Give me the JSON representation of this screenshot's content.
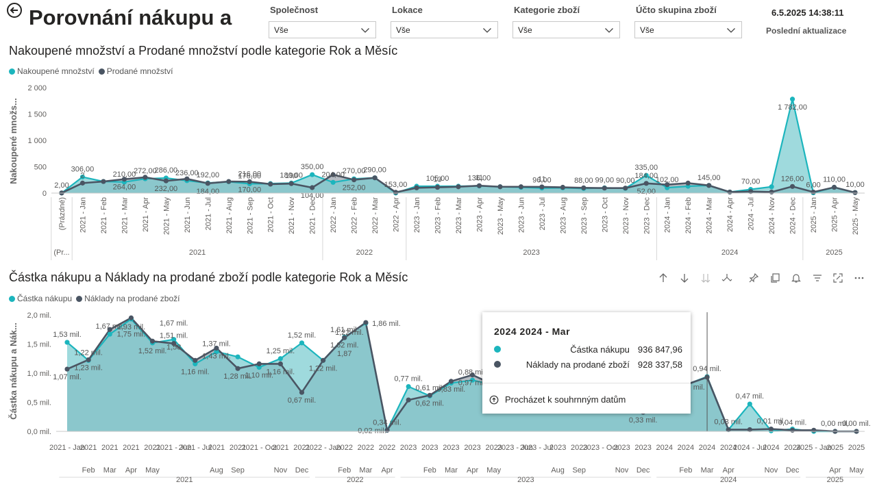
{
  "header": {
    "title": "Porovnání nákupu a",
    "datetime": "6.5.2025 14:38:11",
    "last_update_label": "Poslední aktualizace"
  },
  "slicers": [
    {
      "label": "Společnost",
      "value": "Vše"
    },
    {
      "label": "Lokace",
      "value": "Vše"
    },
    {
      "label": "Kategorie zboží",
      "value": "Vše"
    },
    {
      "label": "Účto skupina zboží",
      "value": "Vše"
    }
  ],
  "colors": {
    "teal": "#1CB5BD",
    "dark": "#4A5563",
    "teal_fill": "#7ACCD0",
    "dark_fill": "#9AA2AC"
  },
  "tooltip": {
    "header": "2024 2024 - Mar",
    "rows": [
      {
        "label": "Částka nákupu",
        "value": "936 847,96"
      },
      {
        "label": "Náklady na prodané zboží",
        "value": "928 337,58"
      }
    ],
    "action": "Procházet k souhrnným datům"
  },
  "toolbar_icons": [
    "arrow-up-icon",
    "arrow-down-icon",
    "double-arrow-down-icon",
    "fork-icon",
    "pin-icon",
    "copy-icon",
    "bell-icon",
    "filter-icon",
    "focus-icon",
    "more-icon"
  ],
  "chart_data": [
    {
      "type": "area",
      "title": "Nakoupené množství a Prodané množství podle kategorie Rok a Měsíc",
      "ylabel": "Nakoupené množs...",
      "ylim": [
        0,
        2000
      ],
      "yticks": [
        "0",
        "500",
        "1 000",
        "1 500",
        "2 000"
      ],
      "legend_position": "top-left",
      "legend": [
        "Nakoupené množství",
        "Prodané množství"
      ],
      "categories": [
        "(Prázdné)",
        "2021 - Jan",
        "2021 - Feb",
        "2021 - Mar",
        "2021 - Apr",
        "2021 - May",
        "2021 - Jun",
        "2021 - Jul",
        "2021 - Aug",
        "2021 - Sep",
        "2021 - Oct",
        "2021 - Nov",
        "2021 - Dec",
        "2022 - Jan",
        "2022 - Feb",
        "2022 - Mar",
        "2022 - Apr",
        "2023 - Jan",
        "2023 - Feb",
        "2023 - Mar",
        "2023 - Apr",
        "2023 - May",
        "2023 - Jun",
        "2023 - Jul",
        "2023 - Aug",
        "2023 - Sep",
        "2023 - Oct",
        "2023 - Nov",
        "2023 - Dec",
        "2024 - Jan",
        "2024 - Feb",
        "2024 - Mar",
        "2024 - Apr",
        "2024 - Jul",
        "2024 - Nov",
        "2024 - Dec",
        "2025 - Jan",
        "2025 - Apr",
        "2025 - May"
      ],
      "year_groups": [
        {
          "label": "(Pr...",
          "start": 0,
          "end": 0
        },
        {
          "label": "2021",
          "start": 1,
          "end": 12
        },
        {
          "label": "2022",
          "start": 13,
          "end": 16
        },
        {
          "label": "2023",
          "start": 17,
          "end": 28
        },
        {
          "label": "2024",
          "start": 29,
          "end": 35
        },
        {
          "label": "2025",
          "start": 36,
          "end": 38
        }
      ],
      "series": [
        {
          "name": "Nakoupené množství",
          "color": "#1CB5BD",
          "values": [
            2,
            306,
            220,
            210,
            272,
            286,
            236,
            192,
            216,
            176,
            180,
            190,
            350,
            204,
            270,
            290,
            2,
            130,
            130,
            130,
            136,
            120,
            110,
            96,
            100,
            88,
            99,
            90,
            335,
            102,
            130,
            145,
            20,
            70,
            120,
            1782,
            6,
            110,
            10
          ]
        },
        {
          "name": "Prodané množství",
          "color": "#4A5563",
          "values": [
            2,
            190,
            220,
            264,
            300,
            232,
            270,
            184,
            220,
            216,
            170,
            180,
            104,
            350,
            252,
            290,
            15,
            100,
            110,
            120,
            140,
            120,
            120,
            118,
            110,
            100,
            95,
            95,
            184,
            160,
            190,
            145,
            20,
            30,
            20,
            126,
            20,
            110,
            10
          ]
        }
      ],
      "data_labels": [
        {
          "i": 0,
          "text": "2,00",
          "s": 0,
          "pos": "above"
        },
        {
          "i": 1,
          "text": "306,00",
          "s": 0,
          "pos": "above"
        },
        {
          "i": 1,
          "text": "2",
          "s": 1,
          "pos": "above"
        },
        {
          "i": 3,
          "text": "210,00",
          "s": 0,
          "pos": "above"
        },
        {
          "i": 3,
          "text": "264,00",
          "s": 1,
          "pos": "below"
        },
        {
          "i": 4,
          "text": "272,00",
          "s": 0,
          "pos": "above"
        },
        {
          "i": 5,
          "text": "286,00",
          "s": 0,
          "pos": "above"
        },
        {
          "i": 5,
          "text": "232,00",
          "s": 1,
          "pos": "below"
        },
        {
          "i": 6,
          "text": "236,00",
          "s": 0,
          "pos": "above"
        },
        {
          "i": 7,
          "text": "192,00",
          "s": 0,
          "pos": "above"
        },
        {
          "i": 7,
          "text": "184,00",
          "s": 1,
          "pos": "below"
        },
        {
          "i": 9,
          "text": "176,00",
          "s": 0,
          "pos": "above"
        },
        {
          "i": 9,
          "text": "216,00",
          "s": 1,
          "pos": "above"
        },
        {
          "i": 9,
          "text": "170,00",
          "s": 1,
          "pos": "below"
        },
        {
          "i": 11,
          "text": "180,00",
          "s": 0,
          "pos": "above"
        },
        {
          "i": 11,
          "text": "190",
          "s": 1,
          "pos": "above"
        },
        {
          "i": 12,
          "text": "350,00",
          "s": 0,
          "pos": "above"
        },
        {
          "i": 12,
          "text": "104,00",
          "s": 1,
          "pos": "below"
        },
        {
          "i": 13,
          "text": "204,00",
          "s": 0,
          "pos": "above"
        },
        {
          "i": 14,
          "text": "270,00",
          "s": 0,
          "pos": "above"
        },
        {
          "i": 14,
          "text": "252,00",
          "s": 1,
          "pos": "below"
        },
        {
          "i": 15,
          "text": "290,00",
          "s": 0,
          "pos": "above"
        },
        {
          "i": 16,
          "text": "153,00",
          "s": 1,
          "pos": "above"
        },
        {
          "i": 18,
          "text": "105,00",
          "s": 0,
          "pos": "above"
        },
        {
          "i": 18,
          "text": "13",
          "s": 1,
          "pos": "above"
        },
        {
          "i": 20,
          "text": "136,00",
          "s": 0,
          "pos": "above"
        },
        {
          "i": 20,
          "text": "11",
          "s": 1,
          "pos": "above"
        },
        {
          "i": 23,
          "text": "96,00",
          "s": 0,
          "pos": "above"
        },
        {
          "i": 23,
          "text": "11",
          "s": 1,
          "pos": "above"
        },
        {
          "i": 25,
          "text": "88,00",
          "s": 0,
          "pos": "above"
        },
        {
          "i": 26,
          "text": "99,00",
          "s": 0,
          "pos": "above"
        },
        {
          "i": 27,
          "text": "90,00",
          "s": 0,
          "pos": "above"
        },
        {
          "i": 28,
          "text": "335,00",
          "s": 0,
          "pos": "above"
        },
        {
          "i": 28,
          "text": "184,00",
          "s": 1,
          "pos": "above"
        },
        {
          "i": 28,
          "text": "52,00",
          "s": 1,
          "pos": "below"
        },
        {
          "i": 29,
          "text": "102,00",
          "s": 0,
          "pos": "above"
        },
        {
          "i": 31,
          "text": "145,00",
          "s": 0,
          "pos": "above"
        },
        {
          "i": 33,
          "text": "70,00",
          "s": 0,
          "pos": "above"
        },
        {
          "i": 35,
          "text": "1 782,00",
          "s": 0,
          "pos": "below"
        },
        {
          "i": 35,
          "text": "126,00",
          "s": 1,
          "pos": "above"
        },
        {
          "i": 36,
          "text": "6,00",
          "s": 0,
          "pos": "above"
        },
        {
          "i": 37,
          "text": "110,00",
          "s": 0,
          "pos": "above"
        },
        {
          "i": 38,
          "text": "10,00",
          "s": 0,
          "pos": "above"
        }
      ]
    },
    {
      "type": "area",
      "title": "Částka nákupu a Náklady na prodané zboží podle kategorie Rok a Měsíc",
      "ylabel": "Částka nákupu a Nák...",
      "ylim": [
        0,
        2.0
      ],
      "yticks": [
        "0,0 mil.",
        "0,5 mil.",
        "1,0 mil.",
        "1,5 mil.",
        "2,0 mil."
      ],
      "legend_position": "top-left",
      "legend": [
        "Částka nákupu",
        "Náklady na prodané zboží"
      ],
      "categories": [
        "2021 - Jan",
        "2021 - Feb",
        "2021 - Mar",
        "2021 - Apr",
        "2021 - May",
        "2021 - Jun",
        "2021 - Jul",
        "2021 - Aug",
        "2021 - Sep",
        "2021 - Oct",
        "2021 - Nov",
        "2021 - Dec",
        "2022 - Jan",
        "2022 - Feb",
        "2022 - Mar",
        "2022 - Apr",
        "2023 - Jan",
        "2023 - Feb",
        "2023 - Mar",
        "2023 - Apr",
        "2023 - May",
        "2023 - Jun",
        "2023 - Jul",
        "2023 - Aug",
        "2023 - Sep",
        "2023 - Oct",
        "2023 - Nov",
        "2023 - Dec",
        "2024 - Jan",
        "2024 - Feb",
        "2024 - Mar",
        "2024 - Apr",
        "2024 - Jul",
        "2024 - Nov",
        "2024 - Dec",
        "2025 - Jan",
        "2025 - Apr",
        "2025 - May"
      ],
      "tick_top": [
        "2021 - Jan",
        "2021",
        "2021",
        "2021",
        "2021",
        "2021 - Jun",
        "2021 - Jul",
        "2021",
        "2021",
        "2021 - Oct",
        "2021",
        "2021",
        "2022 - Jan",
        "2022",
        "2022",
        "2022",
        "2023",
        "2023",
        "2023",
        "2023",
        "2023",
        "2023 - Jun",
        "2023 - Jul",
        "2023",
        "2023",
        "2023 - Oct",
        "2023",
        "2023",
        "2024",
        "2024",
        "2024",
        "2024",
        "2024 - Jul",
        "2024",
        "2024",
        "2025 - Jan",
        "2025",
        "2025"
      ],
      "tick_bottom": [
        "",
        "Feb",
        "Mar",
        "Apr",
        "May",
        "",
        "",
        "Aug",
        "Sep",
        "",
        "Nov",
        "Dec",
        "",
        "Feb",
        "Mar",
        "Apr",
        "",
        "Feb",
        "Mar",
        "Apr",
        "May",
        "",
        "",
        "Aug",
        "Sep",
        "",
        "Nov",
        "Dec",
        "",
        "Feb",
        "Mar",
        "Apr",
        "",
        "Nov",
        "Dec",
        "",
        "Apr",
        "May"
      ],
      "year_labels": [
        {
          "label": "2021",
          "start": 0,
          "end": 11
        },
        {
          "label": "2022",
          "start": 12,
          "end": 15
        },
        {
          "label": "2023",
          "start": 16,
          "end": 27
        },
        {
          "label": "2024",
          "start": 28,
          "end": 34
        },
        {
          "label": "2025",
          "start": 35,
          "end": 37
        }
      ],
      "series": [
        {
          "name": "Částka nákupu",
          "color": "#1CB5BD",
          "values": [
            1.53,
            1.22,
            1.67,
            1.93,
            1.52,
            1.58,
            1.16,
            1.37,
            1.28,
            1.1,
            1.25,
            1.52,
            1.22,
            1.62,
            1.86,
            0.02,
            0.77,
            0.61,
            0.83,
            0.88,
            0.8,
            0.6,
            0.6,
            0.6,
            0.6,
            0.5,
            0.45,
            0.33,
            0.6,
            0.8,
            0.94,
            0.03,
            0.47,
            0.01,
            0.04,
            0.0,
            0.0,
            0.0
          ]
        },
        {
          "name": "Náklady na prodané zboží",
          "color": "#4A5563",
          "values": [
            1.07,
            1.23,
            1.75,
            1.95,
            1.55,
            1.51,
            1.22,
            1.43,
            1.08,
            1.16,
            1.16,
            0.67,
            1.22,
            1.61,
            1.87,
            0.02,
            0.54,
            0.62,
            0.86,
            0.97,
            0.8,
            0.6,
            0.6,
            0.6,
            0.6,
            0.5,
            0.45,
            0.33,
            0.6,
            0.8,
            0.93,
            0.03,
            0.03,
            0.04,
            0.02,
            0.02,
            0.0,
            0.0
          ]
        }
      ],
      "data_labels": [
        {
          "i": 0,
          "text": "1,53 mil.",
          "s": 0,
          "pos": "above"
        },
        {
          "i": 0,
          "text": "1,07 mil.",
          "s": 1,
          "pos": "below"
        },
        {
          "i": 1,
          "text": "1,22 mil.",
          "s": 0,
          "pos": "above"
        },
        {
          "i": 1,
          "text": "1,23 mil.",
          "s": 1,
          "pos": "below"
        },
        {
          "i": 2,
          "text": "1,67 mil.",
          "s": 0,
          "pos": "above"
        },
        {
          "i": 3,
          "text": "1,93 mil.",
          "s": 0,
          "pos": "below"
        },
        {
          "i": 3,
          "text": "1,75 mil.",
          "s": 1,
          "pos": "below2"
        },
        {
          "i": 4,
          "text": "1,52 mil.",
          "s": 0,
          "pos": "below"
        },
        {
          "i": 5,
          "text": "1,67 mil.",
          "s": 0,
          "pos": "above2"
        },
        {
          "i": 5,
          "text": "1,51 mil.",
          "s": 1,
          "pos": "above"
        },
        {
          "i": 5,
          "text": "1,58",
          "s": 0,
          "pos": "below"
        },
        {
          "i": 6,
          "text": "1,16 mil.",
          "s": 0,
          "pos": "below"
        },
        {
          "i": 7,
          "text": "1,37 mil.",
          "s": 0,
          "pos": "above"
        },
        {
          "i": 7,
          "text": "1,43 mil.",
          "s": 1,
          "pos": "below"
        },
        {
          "i": 8,
          "text": "1,28 mil.",
          "s": 1,
          "pos": "below"
        },
        {
          "i": 9,
          "text": "1,10 mil.",
          "s": 0,
          "pos": "below"
        },
        {
          "i": 10,
          "text": "1,25 mil.",
          "s": 0,
          "pos": "above"
        },
        {
          "i": 10,
          "text": "1,16 mil.",
          "s": 1,
          "pos": "below"
        },
        {
          "i": 11,
          "text": "1,52 mil.",
          "s": 0,
          "pos": "above"
        },
        {
          "i": 11,
          "text": "0,67 mil.",
          "s": 1,
          "pos": "below"
        },
        {
          "i": 12,
          "text": "1,22 mil.",
          "s": 1,
          "pos": "below"
        },
        {
          "i": 13,
          "text": "1,61 mil.",
          "s": 1,
          "pos": "above"
        },
        {
          "i": 13,
          "text": "1,62 mil.",
          "s": 0,
          "pos": "below"
        },
        {
          "i": 13,
          "text": "1,87",
          "s": 1,
          "pos": "below2"
        },
        {
          "i": 14,
          "text": "1,86 mil.",
          "s": 0,
          "pos": "right"
        },
        {
          "i": 14,
          "text": "1,22 mil.",
          "s": 1,
          "pos": "belowleft"
        },
        {
          "i": 15,
          "text": "0,34 mil.",
          "s": 1,
          "pos": "above"
        },
        {
          "i": 15,
          "text": "0,02 mil.",
          "s": 0,
          "pos": "left"
        },
        {
          "i": 16,
          "text": "0,77 mil.",
          "s": 0,
          "pos": "above"
        },
        {
          "i": 17,
          "text": "0,61 mil.",
          "s": 0,
          "pos": "above"
        },
        {
          "i": 17,
          "text": "0,62 mil.",
          "s": 1,
          "pos": "below"
        },
        {
          "i": 18,
          "text": "0,83 mil.",
          "s": 1,
          "pos": "below"
        },
        {
          "i": 19,
          "text": "0,88 mil.",
          "s": 0,
          "pos": "above"
        },
        {
          "i": 19,
          "text": "0,97 mil.",
          "s": 1,
          "pos": "below"
        },
        {
          "i": 27,
          "text": "0,33 mil.",
          "s": 1,
          "pos": "below"
        },
        {
          "i": 30,
          "text": "0,94 mil.",
          "s": 0,
          "pos": "above"
        },
        {
          "i": 30,
          "text": "0,93 mil.",
          "s": 1,
          "pos": "belowleft"
        },
        {
          "i": 31,
          "text": "0,03 mil.",
          "s": 1,
          "pos": "above"
        },
        {
          "i": 32,
          "text": "0,47 mil.",
          "s": 0,
          "pos": "above"
        },
        {
          "i": 33,
          "text": "0,01 mil.",
          "s": 1,
          "pos": "above"
        },
        {
          "i": 34,
          "text": "0,04 mil.",
          "s": 1,
          "pos": "above"
        },
        {
          "i": 36,
          "text": "0,00 mil.",
          "s": 0,
          "pos": "above"
        },
        {
          "i": 37,
          "text": "0,00 mil.",
          "s": 0,
          "pos": "above"
        }
      ]
    }
  ]
}
